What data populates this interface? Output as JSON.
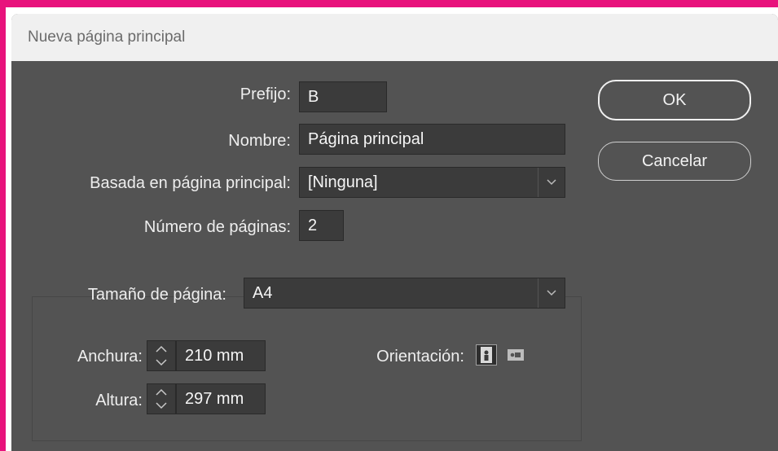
{
  "dialog": {
    "title": "Nueva página principal"
  },
  "form": {
    "prefix_label": "Prefijo:",
    "prefix_value": "B",
    "name_label": "Nombre:",
    "name_value": "Página principal",
    "based_on_label": "Basada en página principal:",
    "based_on_value": "[Ninguna]",
    "pages_label": "Número de páginas:",
    "pages_value": "2"
  },
  "page_size": {
    "label": "Tamaño de página:",
    "value": "A4",
    "width_label": "Anchura:",
    "width_value": "210 mm",
    "height_label": "Altura:",
    "height_value": "297 mm",
    "orientation_label": "Orientación:",
    "orientation_options": [
      "portrait-icon",
      "landscape-icon"
    ],
    "orientation_selected": "portrait"
  },
  "buttons": {
    "ok_label": "OK",
    "cancel_label": "Cancelar"
  },
  "colors": {
    "highlight_border": "#e8127c",
    "dialog_bg": "#535353",
    "field_bg": "#3b3b3b"
  }
}
